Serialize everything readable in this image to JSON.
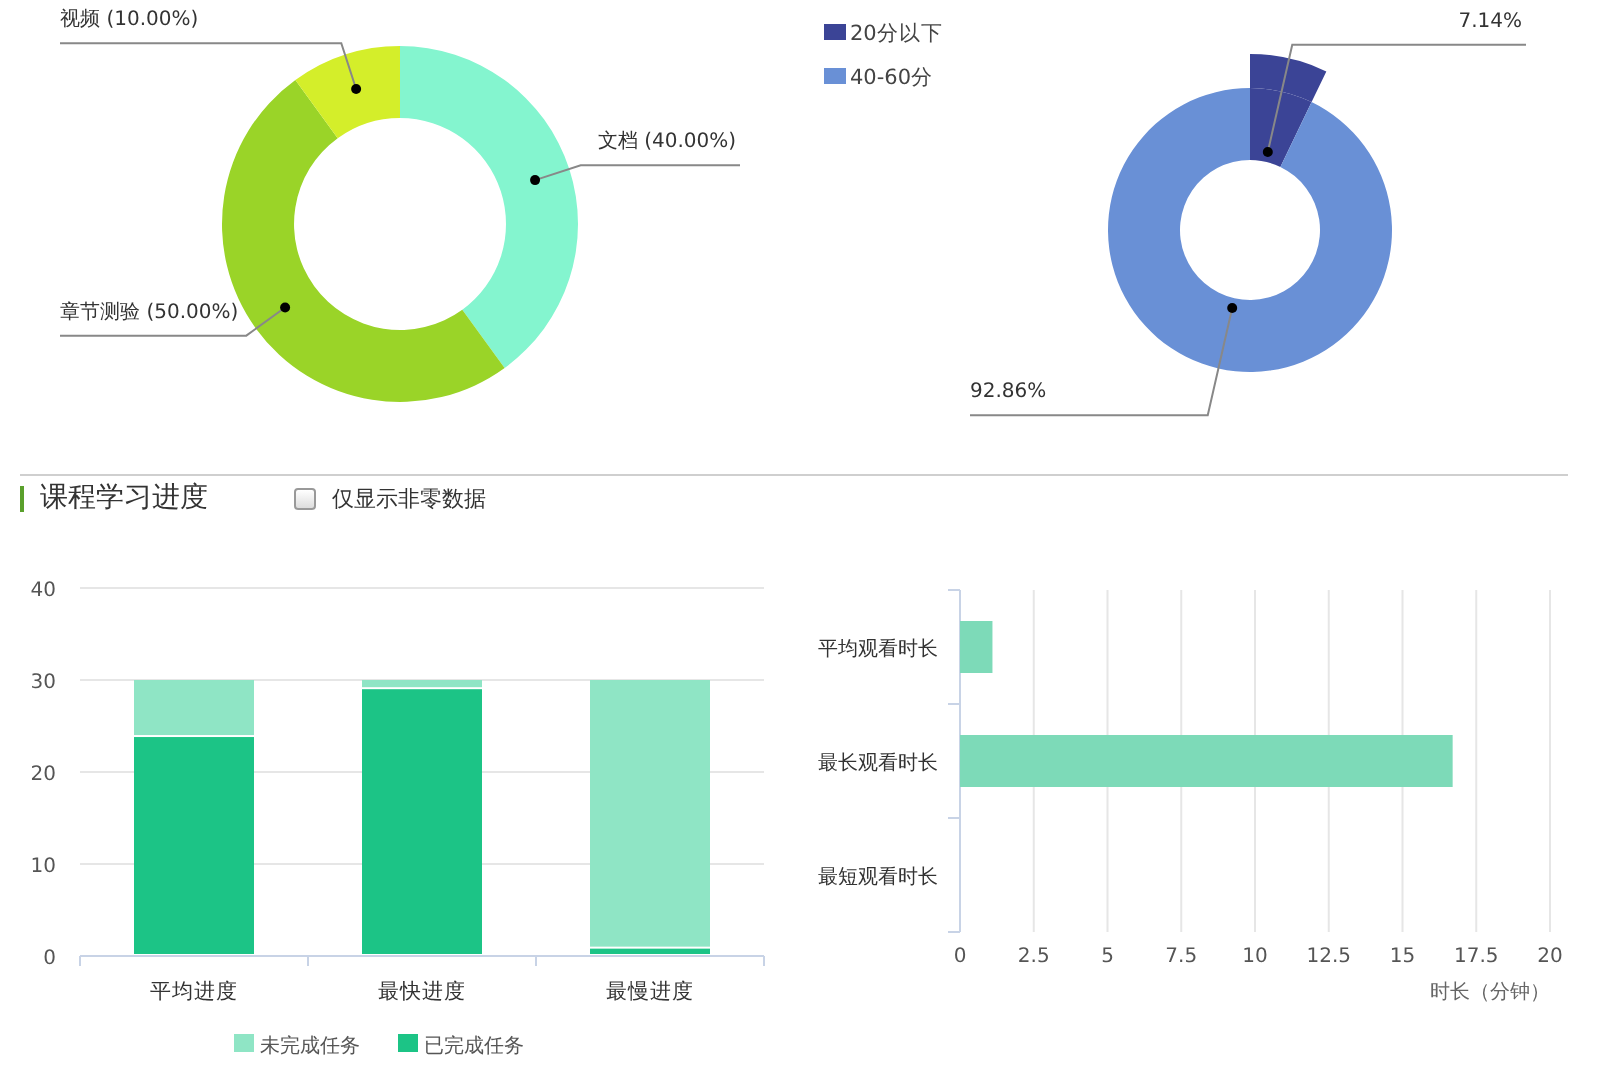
{
  "content_type_chart": {
    "chart_data": {
      "type": "donut",
      "categories": [
        "文档",
        "章节测验",
        "视频"
      ],
      "values": [
        40,
        50,
        10
      ],
      "colors": [
        "#84f5cf",
        "#9ad428",
        "#d4ee2a"
      ],
      "value_labels": [
        "(40.00%)",
        "(50.00%)",
        "(10.00%)"
      ]
    }
  },
  "watch_time_chart": {
    "pulled_out": [
      true,
      false
    ],
    "chart_data": {
      "type": "donut",
      "categories": [
        "20分以下",
        "40-60分"
      ],
      "values": [
        7.14,
        92.86
      ],
      "colors": [
        "#3b4496",
        "#6990d6"
      ],
      "value_labels": [
        "7.14%",
        "92.86%"
      ],
      "legend": true
    }
  },
  "section": {
    "title": "课程学习进度",
    "filter": {
      "label": "仅显示非零数据",
      "checked": false
    }
  },
  "progress_chart": {
    "chart_data": {
      "type": "bar",
      "stacked": true,
      "grid": true,
      "legend": true,
      "categories": [
        "平均进度",
        "最快进度",
        "最慢进度"
      ],
      "yticks": [
        0,
        10,
        20,
        30,
        40
      ],
      "ylim": [
        0,
        40
      ],
      "series": [
        {
          "name": "未完成任务",
          "color": "#8fe5c5",
          "values": [
            6.2,
            1,
            29.2
          ]
        },
        {
          "name": "已完成任务",
          "color": "#1cc486",
          "values": [
            23.8,
            29,
            0.8
          ]
        }
      ]
    }
  },
  "duration_chart": {
    "chart_data": {
      "type": "bar",
      "orientation": "horizontal",
      "grid": true,
      "categories": [
        "平均观看时长",
        "最长观看时长",
        "最短观看时长"
      ],
      "xlabel": "时长（分钟）",
      "xlim": [
        0,
        20
      ],
      "xticks": [
        0,
        2.5,
        5,
        7.5,
        10,
        12.5,
        15,
        17.5,
        20
      ],
      "series": [
        {
          "color": "#7ddab8",
          "values": [
            1.1,
            16.7,
            0
          ]
        }
      ]
    }
  }
}
